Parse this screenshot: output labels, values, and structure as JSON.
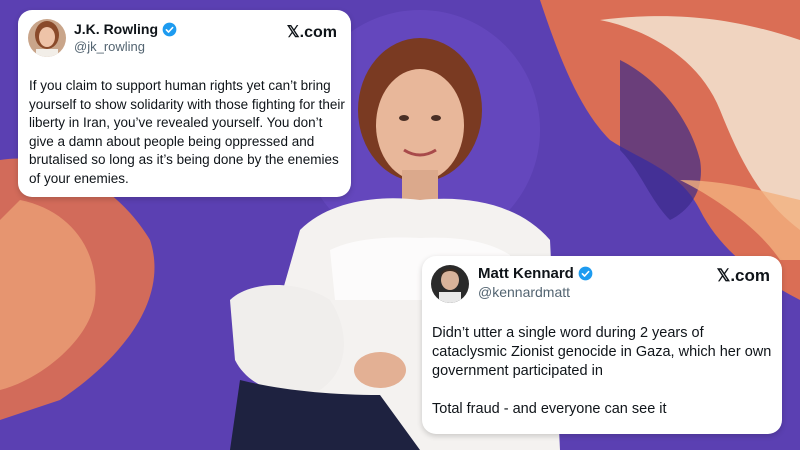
{
  "background": {
    "description_colors": {
      "purple": "#5a3fb0",
      "orange": "#e8734a",
      "cream": "#f3e6d3"
    }
  },
  "tweet1": {
    "name": "J.K. Rowling",
    "handle": "@jk_rowling",
    "brand": "𝕏.com",
    "verified_icon": "verified-badge-icon",
    "text": "If you claim to support human rights yet can’t bring yourself to show solidarity with those fighting for their liberty in Iran, you’ve revealed yourself. You don’t give a damn about people being oppressed and brutalised so long as it’s being done by the enemies of your enemies."
  },
  "tweet2": {
    "name": "Matt Kennard",
    "handle": "@kennardmatt",
    "brand": "𝕏.com",
    "verified_icon": "verified-badge-icon",
    "paragraph1": "Didn’t utter a single word during 2 years of cataclysmic Zionist genocide in Gaza, which her own government participated in",
    "paragraph2": "Total fraud - and everyone can see it"
  },
  "colors": {
    "verified": "#1d9bf0",
    "handle": "#536471",
    "text": "#0f1419"
  }
}
